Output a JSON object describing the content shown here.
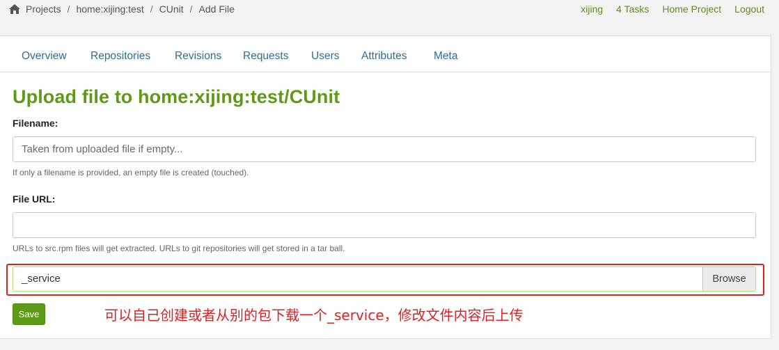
{
  "breadcrumb": {
    "items": [
      "Projects",
      "home:xijing:test",
      "CUnit",
      "Add File"
    ],
    "separator": "/",
    "home_icon": "home-icon"
  },
  "user_nav": {
    "user": "xijing",
    "tasks": "4 Tasks",
    "home_project": "Home Project",
    "logout": "Logout"
  },
  "tabs": [
    "Overview",
    "Repositories",
    "Revisions",
    "Requests",
    "Users",
    "Attributes",
    "Meta"
  ],
  "page_title": "Upload file to home:xijing:test/CUnit",
  "form": {
    "filename_label": "Filename:",
    "filename_placeholder": "Taken from uploaded file if empty...",
    "filename_value": "",
    "filename_help": "If only a filename is provided, an empty file is created (touched).",
    "file_url_label": "File URL:",
    "file_url_value": "",
    "file_url_help": "URLs to src.rpm files will get extracted. URLs to git repositories will get stored in a tar ball.",
    "file_selected": "_service",
    "browse_label": "Browse",
    "save_label": "Save"
  },
  "annotation": {
    "text": "可以自己创建或者从别的包下载一个_service，修改文件内容后上传",
    "color": "#e02020"
  },
  "colors": {
    "accent_green": "#5d9b17",
    "link_blue": "#2f6b97"
  }
}
